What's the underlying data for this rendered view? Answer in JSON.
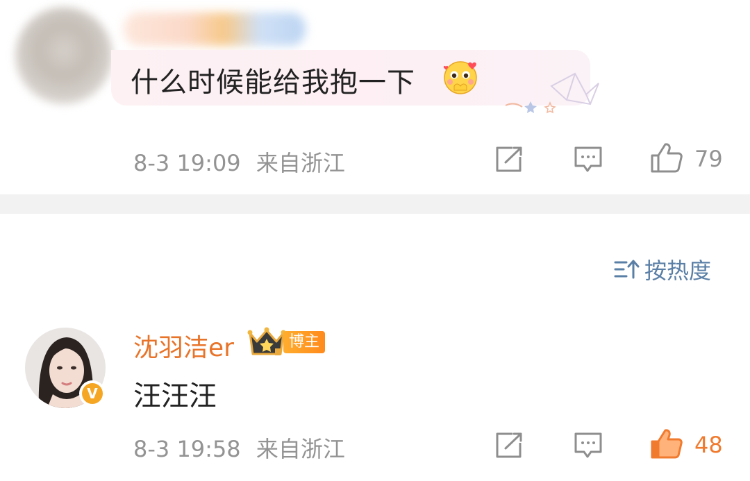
{
  "comment1": {
    "text": "什么时候能给我抱一下",
    "emoji": "shy-blush-emoji",
    "time": "8-3 19:09",
    "location": "来自浙江",
    "likes": "79"
  },
  "sort": {
    "label": "按热度",
    "icon": "sort-icon"
  },
  "comment2": {
    "username": "沈羽洁er",
    "badge": "博主",
    "verified_mark": "V",
    "text": "汪汪汪",
    "time": "8-3 19:58",
    "location": "来自浙江",
    "likes": "48"
  },
  "colors": {
    "meta_gray": "#939393",
    "username_orange": "#e8742a",
    "liked_orange": "#f07a2e",
    "sort_blue": "#5a7fa6",
    "divider": "#f2f2f2"
  }
}
